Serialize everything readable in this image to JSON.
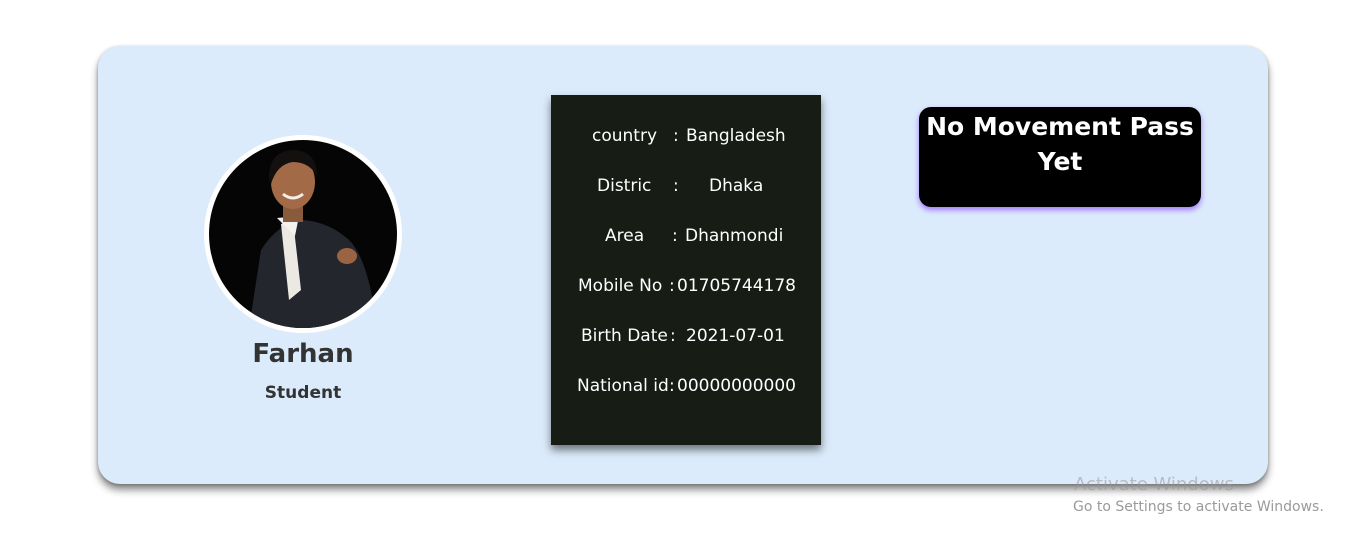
{
  "profile": {
    "name": "Farhan",
    "role": "Student",
    "photo_alt": "profile photo"
  },
  "info": [
    {
      "label": "country",
      "sep": ":",
      "value": "Bangladesh"
    },
    {
      "label": "Distric",
      "sep": ":",
      "value": "Dhaka"
    },
    {
      "label": "Area",
      "sep": ":",
      "value": "Dhanmondi"
    },
    {
      "label": "Mobile No",
      "sep": ":",
      "value": "01705744178"
    },
    {
      "label": "Birth Date",
      "sep": ":",
      "value": "2021-07-01"
    },
    {
      "label": "National id",
      "sep": ":",
      "value": "00000000000"
    }
  ],
  "status_badge": {
    "line1": "No Movement Pass",
    "line2": "Yet"
  },
  "watermark": {
    "title": "Activate Windows",
    "subtitle": "Go to Settings to activate Windows."
  },
  "colors": {
    "card_bg": "#dbebfb",
    "panel_bg": "#171c15",
    "badge_bg": "#000000",
    "badge_glow": "#965aff"
  }
}
